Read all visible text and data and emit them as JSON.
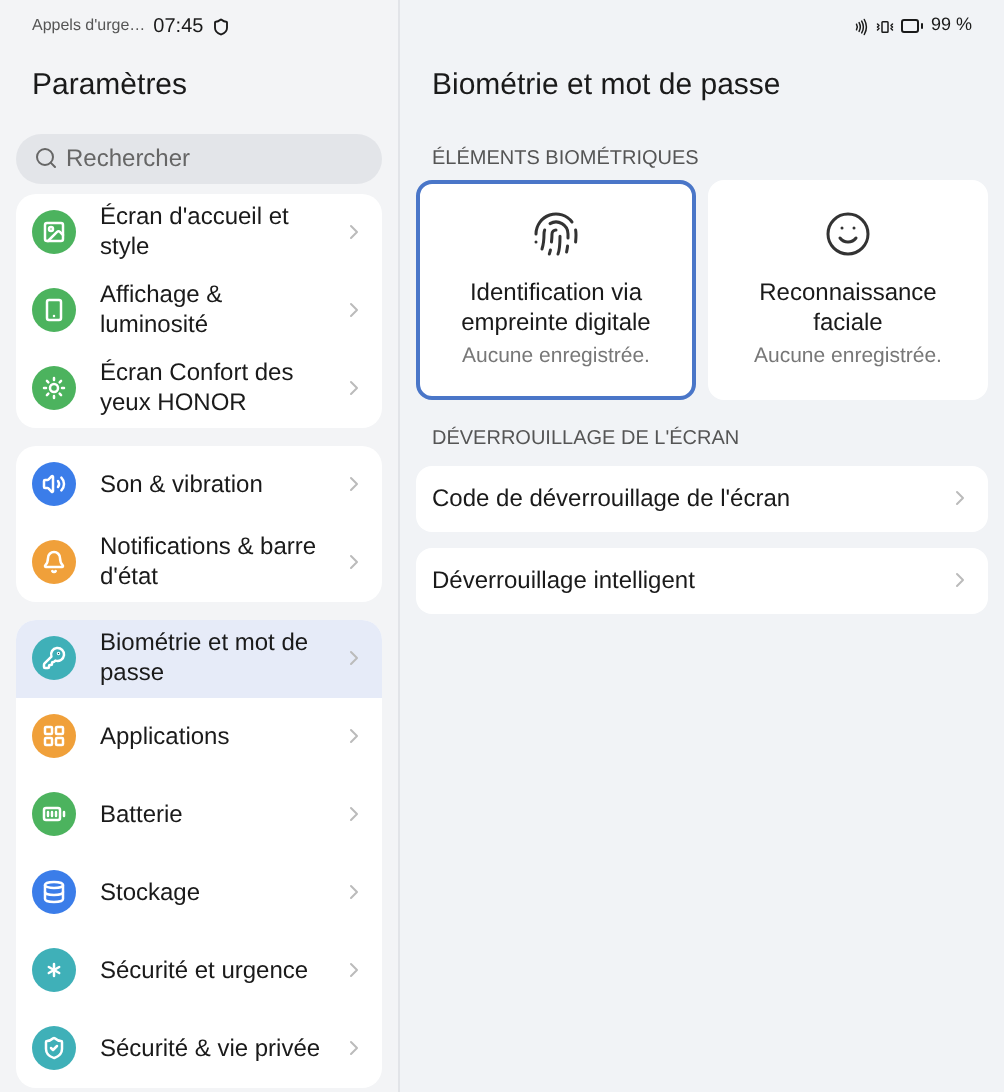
{
  "status_bar": {
    "carrier": "Appels d'urge…",
    "time": "07:45",
    "battery": "99 %"
  },
  "sidebar": {
    "title": "Paramètres",
    "search": {
      "placeholder": "Rechercher"
    },
    "groups": [
      {
        "items": [
          {
            "label": "Écran d'accueil et style",
            "color": "#4cb35e",
            "selected": false
          },
          {
            "label": "Affichage & luminosité",
            "color": "#4cb35e",
            "selected": false
          },
          {
            "label": "Écran Confort des yeux HONOR",
            "color": "#4cb35e",
            "selected": false
          }
        ]
      },
      {
        "items": [
          {
            "label": "Son & vibration",
            "color": "#3b7de9",
            "selected": false
          },
          {
            "label": "Notifications & barre d'état",
            "color": "#f0a03a",
            "selected": false
          }
        ]
      },
      {
        "items": [
          {
            "label": "Biométrie et mot de passe",
            "color": "#3fb0b8",
            "selected": true
          },
          {
            "label": "Applications",
            "color": "#f0a03a",
            "selected": false
          },
          {
            "label": "Batterie",
            "color": "#4cb35e",
            "selected": false
          },
          {
            "label": "Stockage",
            "color": "#3b7de9",
            "selected": false
          },
          {
            "label": "Sécurité et urgence",
            "color": "#3fb0b8",
            "selected": false
          },
          {
            "label": "Sécurité & vie privée",
            "color": "#3fb0b8",
            "selected": false
          }
        ]
      }
    ]
  },
  "detail": {
    "title": "Biométrie et mot de passe",
    "sections": [
      {
        "header": "ÉLÉMENTS BIOMÉTRIQUES",
        "kind": "cards",
        "items": [
          {
            "label": "Identification via empreinte digitale",
            "status": "Aucune enregistrée.",
            "selected": true
          },
          {
            "label": "Reconnaissance faciale",
            "status": "Aucune enregistrée.",
            "selected": false
          }
        ]
      },
      {
        "header": "DÉVERROUILLAGE DE L'ÉCRAN",
        "kind": "rows",
        "items": [
          {
            "label": "Code de déverrouillage de l'écran"
          },
          {
            "label": "Déverrouillage intelligent"
          }
        ]
      }
    ]
  }
}
